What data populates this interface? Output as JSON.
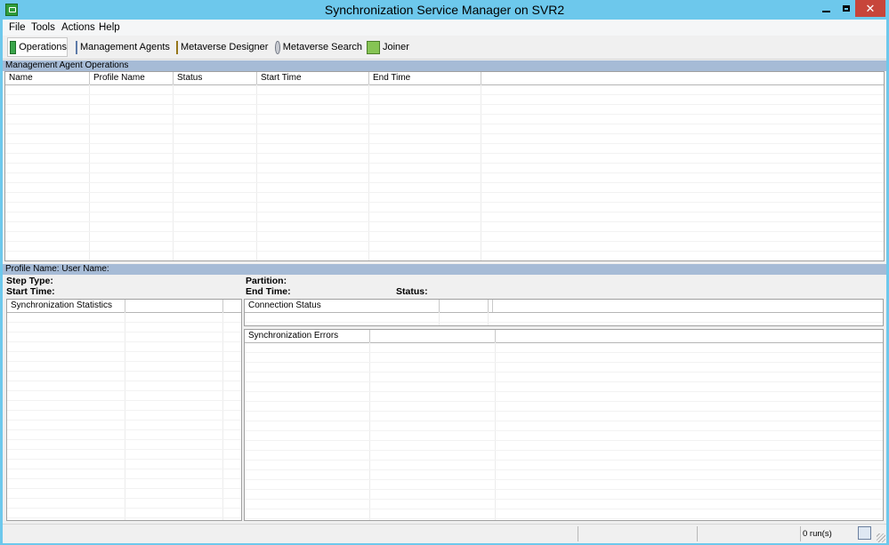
{
  "window": {
    "title": "Synchronization Service Manager on SVR2"
  },
  "menu": [
    "File",
    "Tools",
    "Actions",
    "Help"
  ],
  "toolbar": [
    {
      "label": "Operations",
      "icon": "operations-icon"
    },
    {
      "label": "Management Agents",
      "icon": "management-agents-icon"
    },
    {
      "label": "Metaverse Designer",
      "icon": "metaverse-designer-icon"
    },
    {
      "label": "Metaverse Search",
      "icon": "metaverse-search-icon"
    },
    {
      "label": "Joiner",
      "icon": "joiner-icon"
    }
  ],
  "operations": {
    "section_title": "Management Agent Operations",
    "columns": [
      "Name",
      "Profile Name",
      "Status",
      "Start Time",
      "End Time"
    ]
  },
  "details": {
    "band": "Profile Name:   User Name:",
    "step_type_label": "Step Type:",
    "start_time_label": "Start Time:",
    "partition_label": "Partition:",
    "end_time_label": "End Time:",
    "status_label": "Status:"
  },
  "sync_stats": {
    "columns": [
      "Synchronization Statistics",
      ""
    ]
  },
  "connection_status": {
    "columns": [
      "Connection Status",
      "",
      ""
    ]
  },
  "sync_errors": {
    "columns": [
      "Synchronization Errors",
      ""
    ]
  },
  "statusbar": {
    "runs": "0 run(s)"
  },
  "colors": {
    "title_bg": "#6dc8ec",
    "band": "#a6bbd6",
    "close": "#c7453a"
  }
}
